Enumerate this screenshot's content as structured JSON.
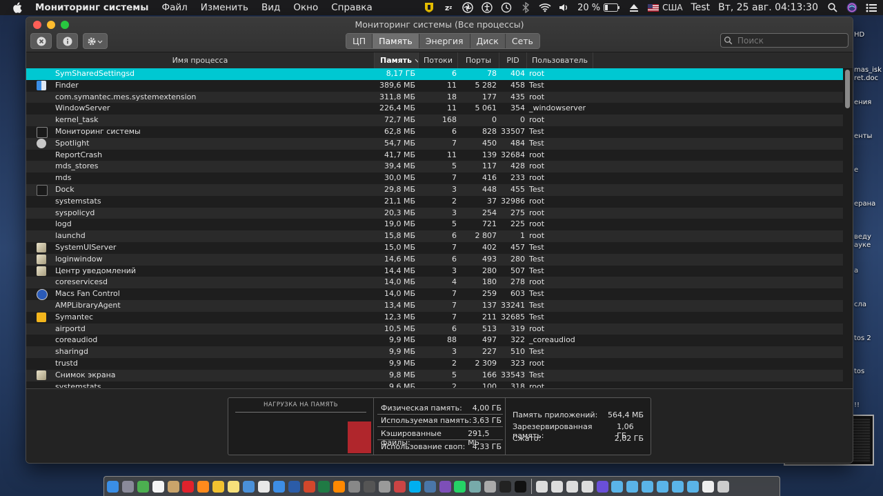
{
  "menubar": {
    "app_name": "Мониторинг системы",
    "menus": [
      "Файл",
      "Изменить",
      "Вид",
      "Окно",
      "Справка"
    ],
    "battery": "20 %",
    "input_lang": "США",
    "user": "Test",
    "datetime": "Вт, 25 авг.  04:13:30"
  },
  "window": {
    "title": "Мониторинг системы (Все процессы)",
    "tabs": [
      "ЦП",
      "Память",
      "Энергия",
      "Диск",
      "Сеть"
    ],
    "active_tab": "Память",
    "search_placeholder": "Поиск"
  },
  "table": {
    "columns": {
      "name": "Имя процесса",
      "memory": "Память",
      "threads": "Потоки",
      "ports": "Порты",
      "pid": "PID",
      "user": "Пользователь"
    },
    "rows": [
      {
        "name": "SymSharedSettingsd",
        "memory": "8,17 ГБ",
        "threads": "6",
        "ports": "78",
        "pid": "404",
        "user": "root",
        "icon": "none",
        "selected": true
      },
      {
        "name": "Finder",
        "memory": "389,6 МБ",
        "threads": "11",
        "ports": "5 282",
        "pid": "458",
        "user": "Test",
        "icon": "finder-icon"
      },
      {
        "name": "com.symantec.mes.systemextension",
        "memory": "311,8 МБ",
        "threads": "18",
        "ports": "177",
        "pid": "435",
        "user": "root",
        "icon": "none"
      },
      {
        "name": "WindowServer",
        "memory": "226,4 МБ",
        "threads": "11",
        "ports": "5 061",
        "pid": "354",
        "user": "_windowserver",
        "icon": "none"
      },
      {
        "name": "kernel_task",
        "memory": "72,7 МБ",
        "threads": "168",
        "ports": "0",
        "pid": "0",
        "user": "root",
        "icon": "none"
      },
      {
        "name": "Мониторинг системы",
        "memory": "62,8 МБ",
        "threads": "6",
        "ports": "828",
        "pid": "33507",
        "user": "Test",
        "icon": "activity-monitor-icon"
      },
      {
        "name": "Spotlight",
        "memory": "54,7 МБ",
        "threads": "7",
        "ports": "450",
        "pid": "484",
        "user": "Test",
        "icon": "spotlight-icon"
      },
      {
        "name": "ReportCrash",
        "memory": "41,7 МБ",
        "threads": "11",
        "ports": "139",
        "pid": "32684",
        "user": "root",
        "icon": "none"
      },
      {
        "name": "mds_stores",
        "memory": "39,4 МБ",
        "threads": "5",
        "ports": "117",
        "pid": "428",
        "user": "root",
        "icon": "none"
      },
      {
        "name": "mds",
        "memory": "30,0 МБ",
        "threads": "7",
        "ports": "416",
        "pid": "233",
        "user": "root",
        "icon": "none"
      },
      {
        "name": "Dock",
        "memory": "29,8 МБ",
        "threads": "3",
        "ports": "448",
        "pid": "455",
        "user": "Test",
        "icon": "dock-icon"
      },
      {
        "name": "systemstats",
        "memory": "21,1 МБ",
        "threads": "2",
        "ports": "37",
        "pid": "32986",
        "user": "root",
        "icon": "none"
      },
      {
        "name": "syspolicyd",
        "memory": "20,3 МБ",
        "threads": "3",
        "ports": "254",
        "pid": "275",
        "user": "root",
        "icon": "none"
      },
      {
        "name": "logd",
        "memory": "19,0 МБ",
        "threads": "5",
        "ports": "721",
        "pid": "225",
        "user": "root",
        "icon": "none"
      },
      {
        "name": "launchd",
        "memory": "15,8 МБ",
        "threads": "6",
        "ports": "2 807",
        "pid": "1",
        "user": "root",
        "icon": "none"
      },
      {
        "name": "SystemUIServer",
        "memory": "15,0 МБ",
        "threads": "7",
        "ports": "402",
        "pid": "457",
        "user": "Test",
        "icon": "generic-app-icon"
      },
      {
        "name": "loginwindow",
        "memory": "14,6 МБ",
        "threads": "6",
        "ports": "493",
        "pid": "280",
        "user": "Test",
        "icon": "generic-app-icon"
      },
      {
        "name": "Центр уведомлений",
        "memory": "14,4 МБ",
        "threads": "3",
        "ports": "280",
        "pid": "507",
        "user": "Test",
        "icon": "notification-center-icon"
      },
      {
        "name": "coreservicesd",
        "memory": "14,0 МБ",
        "threads": "4",
        "ports": "180",
        "pid": "278",
        "user": "root",
        "icon": "none"
      },
      {
        "name": "Macs Fan Control",
        "memory": "14,0 МБ",
        "threads": "7",
        "ports": "259",
        "pid": "603",
        "user": "Test",
        "icon": "fan-control-icon"
      },
      {
        "name": "AMPLibraryAgent",
        "memory": "13,4 МБ",
        "threads": "7",
        "ports": "137",
        "pid": "33241",
        "user": "Test",
        "icon": "none"
      },
      {
        "name": "Symantec",
        "memory": "12,3 МБ",
        "threads": "7",
        "ports": "211",
        "pid": "32685",
        "user": "Test",
        "icon": "symantec-icon"
      },
      {
        "name": "airportd",
        "memory": "10,5 МБ",
        "threads": "6",
        "ports": "513",
        "pid": "319",
        "user": "root",
        "icon": "none"
      },
      {
        "name": "coreaudiod",
        "memory": "9,9 МБ",
        "threads": "88",
        "ports": "497",
        "pid": "322",
        "user": "_coreaudiod",
        "icon": "none"
      },
      {
        "name": "sharingd",
        "memory": "9,9 МБ",
        "threads": "3",
        "ports": "227",
        "pid": "510",
        "user": "Test",
        "icon": "none"
      },
      {
        "name": "trustd",
        "memory": "9,9 МБ",
        "threads": "2",
        "ports": "2 309",
        "pid": "323",
        "user": "root",
        "icon": "none"
      },
      {
        "name": "Снимок экрана",
        "memory": "9,8 МБ",
        "threads": "5",
        "ports": "166",
        "pid": "33543",
        "user": "Test",
        "icon": "screenshot-icon"
      },
      {
        "name": "systemstats",
        "memory": "9,6 МБ",
        "threads": "2",
        "ports": "100",
        "pid": "318",
        "user": "root",
        "icon": "none"
      }
    ]
  },
  "memory_panel": {
    "pressure_title": "НАГРУЗКА НА ПАМЯТЬ",
    "pressure_level": 0.5,
    "physical_label": "Физическая память:",
    "physical_value": "4,00 ГБ",
    "used_label": "Используемая память:",
    "used_value": "3,63 ГБ",
    "cached_label": "Кэшированные файлы:",
    "cached_value": "291,5 МБ",
    "swap_label": "Использование своп:",
    "swap_value": "4,33 ГБ",
    "app_label": "Память приложений:",
    "app_value": "564,4 МБ",
    "wired_label": "Зарезервированная память:",
    "wired_value": "1,06 ГБ",
    "compressed_label": "Сжато:",
    "compressed_value": "2,02 ГБ"
  },
  "desktop_labels": [
    "HD",
    "mas_isk",
    "ret.doc",
    "ения",
    "енты",
    "е",
    "ерана",
    "веду",
    "ауке",
    "а",
    "сла",
    "tos 2",
    "tos",
    "!!"
  ],
  "colors": {
    "selected_row": "#00c8d2",
    "pressure_bar": "#b0262c",
    "close": "#ff5f57",
    "minimize": "#febc2e",
    "zoom": "#28c840"
  }
}
